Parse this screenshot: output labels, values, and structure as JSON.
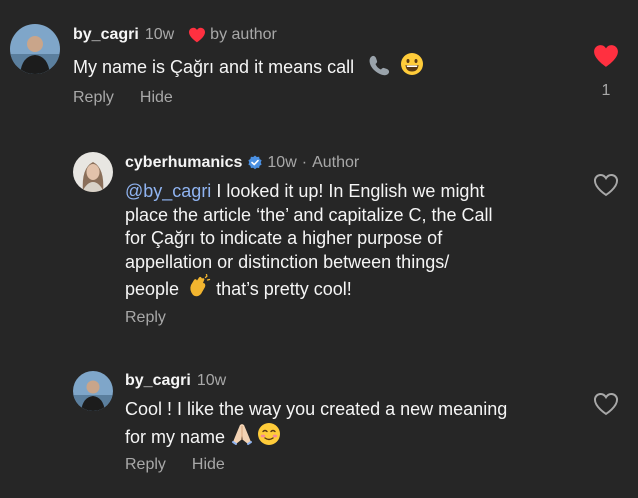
{
  "comments": [
    {
      "username": "by_cagri",
      "time": "10w",
      "liked_by": "by author",
      "text": "My name is Çağrı and it means call",
      "actions": {
        "reply": "Reply",
        "hide": "Hide"
      },
      "like_count": "1",
      "liked": true
    },
    {
      "username": "cyberhumanics",
      "time": "10w",
      "role": "Author",
      "verified": true,
      "mention": "@by_cagri",
      "lines": [
        " I looked it up! In English we might",
        "place the article ‘the’ and capitalize C, the Call",
        "for Çağrı to indicate a higher purpose of",
        "appellation or distinction between things/",
        "people",
        " that’s pretty cool!"
      ],
      "actions": {
        "reply": "Reply"
      }
    },
    {
      "username": "by_cagri",
      "time": "10w",
      "lines": [
        "Cool ! I like the way you created a new meaning",
        "for my name"
      ],
      "actions": {
        "reply": "Reply",
        "hide": "Hide"
      }
    }
  ],
  "colors": {
    "background": "#262626",
    "text": "#f5f5f5",
    "muted": "#a8a8a8",
    "heart_red": "#ff3040",
    "mention": "#8fb3f0",
    "verified": "#4a90e2"
  },
  "icons": [
    "heart-filled-icon",
    "heart-outline-icon",
    "verified-badge-icon",
    "telephone-emoji",
    "grinning-emoji",
    "clapping-hands-emoji",
    "folded-hands-emoji",
    "smiling-emoji"
  ]
}
